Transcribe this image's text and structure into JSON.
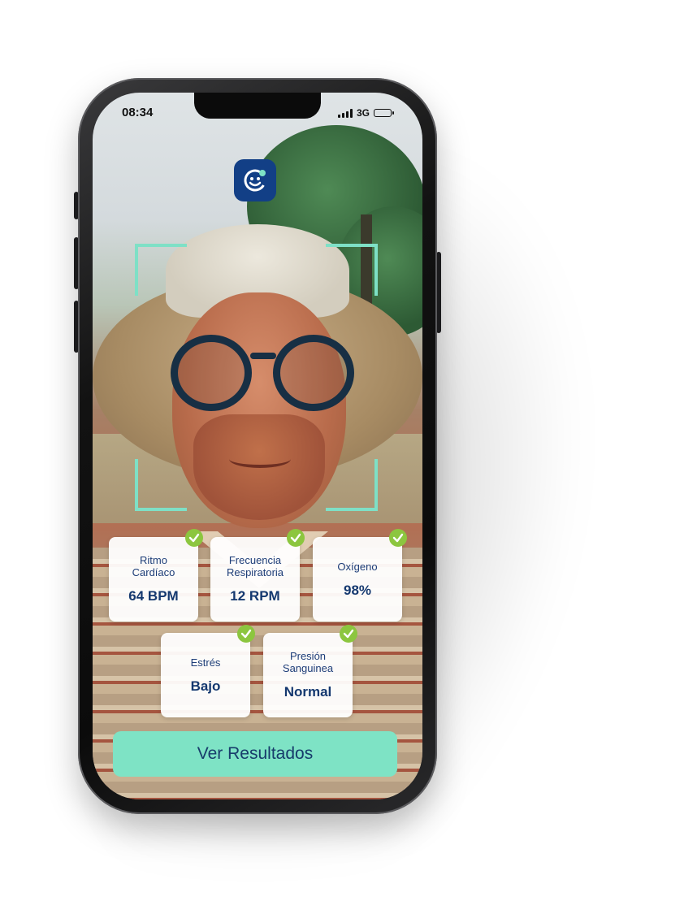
{
  "status_bar": {
    "time": "08:34",
    "network": "3G",
    "battery_level": 1.0,
    "battery_color": "#34c759"
  },
  "app": {
    "logo_icon": "face-scan-logo-icon",
    "accent_color": "#7ee3c5",
    "brand_color": "#123f86"
  },
  "scan_frame": {
    "icon": "face-scan-frame",
    "color": "#7ee0c6"
  },
  "metrics": [
    {
      "label_lines": [
        "Ritmo",
        "Cardíaco"
      ],
      "value": "64 BPM",
      "status_icon": "check-icon"
    },
    {
      "label_lines": [
        "Frecuencia",
        "Respiratoria"
      ],
      "value": "12 RPM",
      "status_icon": "check-icon"
    },
    {
      "label_lines": [
        "Oxígeno"
      ],
      "value": "98%",
      "status_icon": "check-icon"
    },
    {
      "label_lines": [
        "Estrés"
      ],
      "value": "Bajo",
      "status_icon": "check-icon"
    },
    {
      "label_lines": [
        "Presión",
        "Sanguinea"
      ],
      "value": "Normal",
      "status_icon": "check-icon"
    }
  ],
  "cta": {
    "label": "Ver Resultados"
  }
}
